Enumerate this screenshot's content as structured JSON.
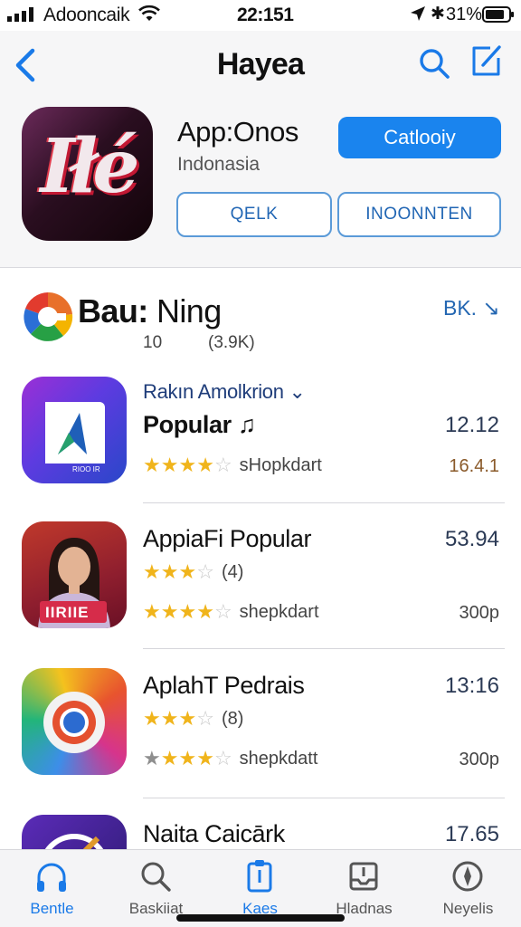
{
  "status_bar": {
    "carrier": "Adooncaik",
    "time": "22:151",
    "battery_pct": "31%",
    "bluetooth_glyph": "✱"
  },
  "header": {
    "title": "Hayea",
    "back_icon": "chevron-left-icon",
    "search_icon": "search-icon",
    "compose_icon": "compose-icon"
  },
  "app": {
    "icon_text": "Iłé",
    "name": "App:Onos",
    "region": "Indonasia",
    "primary_button": "Catlooiy",
    "secondary_button_left": "QELK",
    "secondary_button_right": "INOONNTEN"
  },
  "section": {
    "title_part1": "Bau:",
    "title_part2": "Ning",
    "more": "BK. ↘",
    "meta_a": "10",
    "meta_b": "(3.9K)"
  },
  "rows": [
    {
      "subtitle": "Rakın Amolkrion ⌄",
      "title": "Popular ♫",
      "value": "12.12",
      "value2": "16.4.1",
      "rating": 4,
      "rating_label": "sHopkdart",
      "icon_caption": "RIOO IR"
    },
    {
      "title": "AppiaFi Popular",
      "value": "53.94",
      "rating_a": 3,
      "rating_a_label": "(4)",
      "rating_b": 4,
      "rating_b_label": "shepkdart",
      "value2": "300p",
      "icon_caption": "IIRIIE"
    },
    {
      "title": "AplahT Pedrais",
      "value": "13:16",
      "rating_a": 3,
      "rating_a_label": "(8)",
      "rating_b": 4,
      "rating_b_label": "shepkdatt",
      "value2": "300p"
    },
    {
      "title": "Naita Caicārk",
      "value": "17.65"
    }
  ],
  "tabbar": [
    {
      "label": "Bentle",
      "icon": "headphones-icon",
      "active": true
    },
    {
      "label": "Baskiiat",
      "icon": "search-icon",
      "active": false
    },
    {
      "label": "Kaes",
      "icon": "clipboard-icon",
      "active": true
    },
    {
      "label": "Hladnas",
      "icon": "tray-icon",
      "active": false
    },
    {
      "label": "Neyelis",
      "icon": "compass-icon",
      "active": false
    }
  ],
  "colors": {
    "accent": "#1a84ee",
    "star": "#f0b41b",
    "tab_active": "#1a7ae8"
  }
}
